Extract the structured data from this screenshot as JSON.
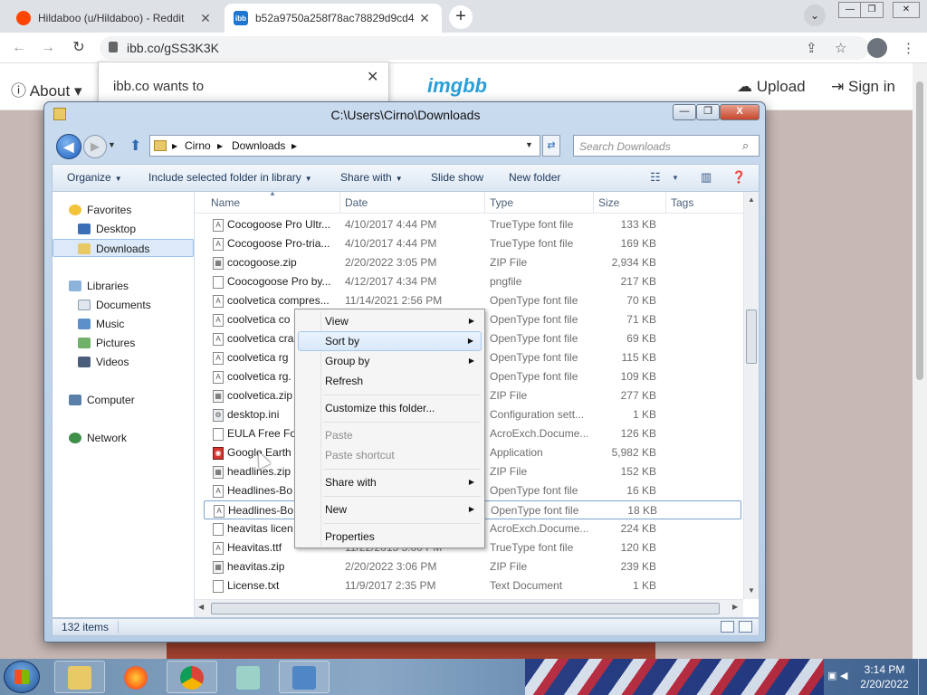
{
  "browser": {
    "tabs": [
      {
        "title": "Hildaboo (u/Hildaboo) - Reddit",
        "close": "✕"
      },
      {
        "title": "b52a9750a258f78ac78829d9cd4",
        "close": "✕"
      }
    ],
    "new_tab": "+",
    "chevron": "⌄",
    "window_buttons": [
      "—",
      "❐",
      "✕"
    ],
    "address": "ibb.co/gSS3K3K"
  },
  "page": {
    "about": "About",
    "brand": "imgbb",
    "upload": "Upload",
    "sign_in": "Sign in",
    "popup_message": "ibb.co wants to",
    "popup_close": "✕"
  },
  "explorer": {
    "title": "C:\\Users\\Cirno\\Downloads",
    "caption_buttons": [
      "—",
      "❐",
      "X"
    ],
    "breadcrumb": [
      "Cirno",
      "Downloads"
    ],
    "search_placeholder": "Search Downloads",
    "toolbar": {
      "organize": "Organize",
      "include": "Include selected folder in library",
      "share_with": "Share with",
      "slide_show": "Slide show",
      "new_folder": "New folder"
    },
    "nav": {
      "favorites": "Favorites",
      "desktop": "Desktop",
      "downloads": "Downloads",
      "libraries": "Libraries",
      "documents": "Documents",
      "music": "Music",
      "pictures": "Pictures",
      "videos": "Videos",
      "computer": "Computer",
      "network": "Network"
    },
    "columns": {
      "name": "Name",
      "date": "Date",
      "type": "Type",
      "size": "Size",
      "tags": "Tags"
    },
    "files": [
      {
        "name": "Cocogoose Pro Ultr...",
        "date": "4/10/2017 4:44 PM",
        "type": "TrueType font file",
        "size": "133 KB",
        "icon": "font-icon"
      },
      {
        "name": "Cocogoose Pro-tria...",
        "date": "4/10/2017 4:44 PM",
        "type": "TrueType font file",
        "size": "169 KB",
        "icon": "font-icon"
      },
      {
        "name": "cocogoose.zip",
        "date": "2/20/2022 3:05 PM",
        "type": "ZIP File",
        "size": "2,934 KB",
        "icon": "zip-icon"
      },
      {
        "name": "Coocogoose Pro by...",
        "date": "4/12/2017 4:34 PM",
        "type": "pngfile",
        "size": "217 KB",
        "icon": "file-icon"
      },
      {
        "name": "coolvetica compres...",
        "date": "11/14/2021 2:56 PM",
        "type": "OpenType font file",
        "size": "70 KB",
        "icon": "font-icon"
      },
      {
        "name": "coolvetica co",
        "date": "",
        "type": "OpenType font file",
        "size": "71 KB",
        "icon": "font-icon"
      },
      {
        "name": "coolvetica cra",
        "date": "",
        "type": "OpenType font file",
        "size": "69 KB",
        "icon": "font-icon"
      },
      {
        "name": "coolvetica rg",
        "date": "",
        "type": "OpenType font file",
        "size": "115 KB",
        "icon": "font-icon"
      },
      {
        "name": "coolvetica rg.",
        "date": "",
        "type": "OpenType font file",
        "size": "109 KB",
        "icon": "font-icon"
      },
      {
        "name": "coolvetica.zip",
        "date": "",
        "type": "ZIP File",
        "size": "277 KB",
        "icon": "zip-icon"
      },
      {
        "name": "desktop.ini",
        "date": "",
        "type": "Configuration sett...",
        "size": "1 KB",
        "icon": "settings-file-icon"
      },
      {
        "name": "EULA Free For",
        "date": "",
        "type": "AcroExch.Docume...",
        "size": "126 KB",
        "icon": "file-icon"
      },
      {
        "name": "Google Earth",
        "date": "",
        "type": "Application",
        "size": "5,982 KB",
        "icon": "app-icon"
      },
      {
        "name": "headlines.zip",
        "date": "",
        "type": "ZIP File",
        "size": "152 KB",
        "icon": "zip-icon"
      },
      {
        "name": "Headlines-Bo",
        "date": "",
        "type": "OpenType font file",
        "size": "16 KB",
        "icon": "font-icon"
      },
      {
        "name": "Headlines-Bo",
        "date": "",
        "type": "OpenType font file",
        "size": "18 KB",
        "icon": "font-icon"
      },
      {
        "name": "heavitas licen",
        "date": "",
        "type": "AcroExch.Docume...",
        "size": "224 KB",
        "icon": "file-icon"
      },
      {
        "name": "Heavitas.ttf",
        "date": "11/22/2015 5:00 PM",
        "type": "TrueType font file",
        "size": "120 KB",
        "icon": "font-icon"
      },
      {
        "name": "heavitas.zip",
        "date": "2/20/2022 3:06 PM",
        "type": "ZIP File",
        "size": "239 KB",
        "icon": "zip-icon"
      },
      {
        "name": "License.txt",
        "date": "11/9/2017 2:35 PM",
        "type": "Text Document",
        "size": "1 KB",
        "icon": "file-icon"
      }
    ],
    "status": "132 items"
  },
  "context_menu": {
    "view": "View",
    "sort_by": "Sort by",
    "group_by": "Group by",
    "refresh": "Refresh",
    "customize": "Customize this folder...",
    "paste": "Paste",
    "paste_shortcut": "Paste shortcut",
    "share_with": "Share with",
    "new": "New",
    "properties": "Properties"
  },
  "taskbar": {
    "time": "3:14 PM",
    "date": "2/20/2022"
  }
}
